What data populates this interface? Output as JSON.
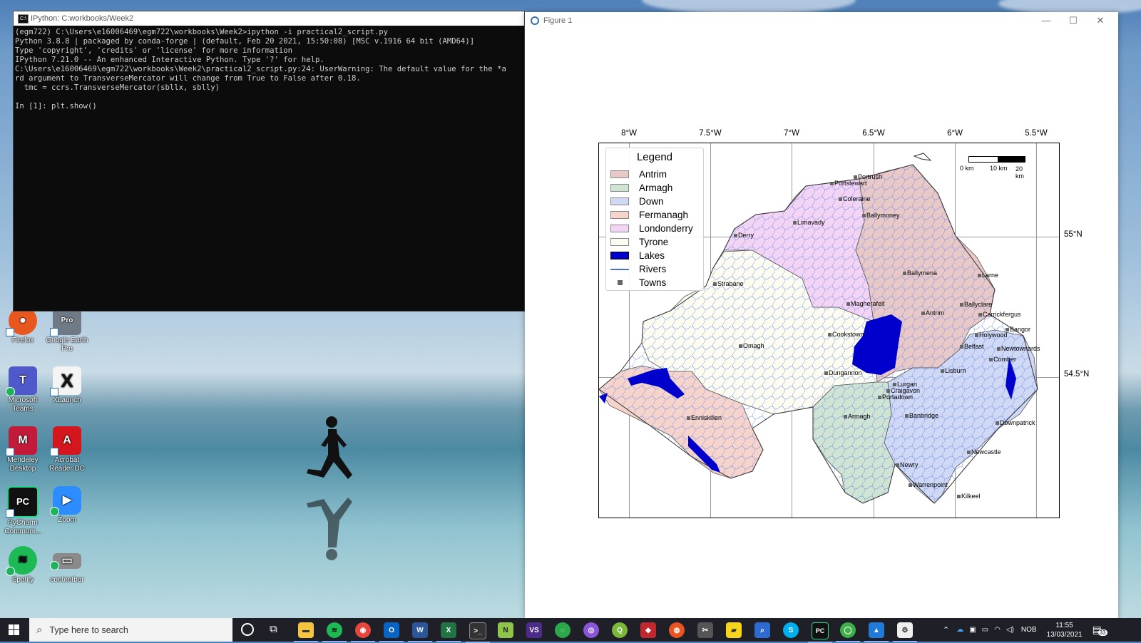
{
  "desktop": {
    "icons": [
      {
        "label": "Firefox",
        "color": "#e8571e",
        "glyph": "●"
      },
      {
        "label": "Google Earth Pro",
        "color": "#6f7a86",
        "glyph": "Pro"
      },
      {
        "label": "Microsoft Teams",
        "color": "#5059c9",
        "glyph": "T"
      },
      {
        "label": "XLaunch",
        "color": "#f4f4f4",
        "glyph": "X"
      },
      {
        "label": "Mendeley Desktop",
        "color": "#c31a3a",
        "glyph": "M"
      },
      {
        "label": "Acrobat Reader DC",
        "color": "#d4161e",
        "glyph": "A"
      },
      {
        "label": "PyCharm Communi...",
        "color": "#111111",
        "glyph": "PC"
      },
      {
        "label": "Zoom",
        "color": "#2d8cff",
        "glyph": "▶"
      },
      {
        "label": "Spotify",
        "color": "#1db954",
        "glyph": "≋"
      },
      {
        "label": "contentbar",
        "color": "#8a8a8a",
        "glyph": "▭"
      }
    ]
  },
  "console": {
    "title": "IPython: C:workbooks/Week2",
    "lines": [
      "(egm722) C:\\Users\\e16006469\\egm722\\workbooks\\Week2>ipython -i practical2_script.py",
      "Python 3.8.8 | packaged by conda-forge | (default, Feb 20 2021, 15:50:08) [MSC v.1916 64 bit (AMD64)]",
      "Type 'copyright', 'credits' or 'license' for more information",
      "IPython 7.21.0 -- An enhanced Interactive Python. Type '?' for help.",
      "C:\\Users\\e16006469\\egm722\\workbooks\\Week2\\practical2_script.py:24: UserWarning: The default value for the *a",
      "rd argument to TransverseMercator will change from True to False after 0.18.",
      "  tmc = ccrs.TransverseMercator(sbllx, sblly)",
      "",
      "In [1]: plt.show()"
    ]
  },
  "figure": {
    "title": "Figure 1",
    "buttons": {
      "minimize": "—",
      "maximize": "☐",
      "close": "✕"
    }
  },
  "chart_data": {
    "type": "map",
    "lon_ticks": [
      "8°W",
      "7.5°W",
      "7°W",
      "6.5°W",
      "6°W",
      "5.5°W"
    ],
    "lat_ticks": [
      "55°N",
      "54.5°N"
    ],
    "legend": {
      "title": "Legend",
      "items": [
        {
          "label": "Antrim",
          "color": "#e9c8c8",
          "kind": "patch"
        },
        {
          "label": "Armagh",
          "color": "#cfe4d2",
          "kind": "patch"
        },
        {
          "label": "Down",
          "color": "#cfd8f5",
          "kind": "patch"
        },
        {
          "label": "Fermanagh",
          "color": "#f6d4cc",
          "kind": "patch"
        },
        {
          "label": "Londonderry",
          "color": "#f4d4f4",
          "kind": "patch"
        },
        {
          "label": "Tyrone",
          "color": "#fcfcf0",
          "kind": "patch"
        },
        {
          "label": "Lakes",
          "color": "#0000cc",
          "kind": "patch"
        },
        {
          "label": "Rivers",
          "color": "#4a6fd8",
          "kind": "line"
        },
        {
          "label": "Towns",
          "color": "#666666",
          "kind": "marker"
        }
      ]
    },
    "scale_bar": {
      "labels": [
        "0 km",
        "10 km",
        "20 km"
      ]
    },
    "towns": [
      "Portrush",
      "Portstewart",
      "Coleraine",
      "Ballymoney",
      "Limavady",
      "Derry",
      "Ballymena",
      "Larne",
      "Strabane",
      "Magherafelt",
      "Antrim",
      "Ballyclare",
      "Carrickfergus",
      "Bangor",
      "Holywood",
      "Cookstown",
      "Belfast",
      "Newtownards",
      "Omagh",
      "Comber",
      "Dungannon",
      "Lisburn",
      "Lurgan",
      "Craigavon",
      "Portadown",
      "Armagh",
      "Banbridge",
      "Enniskillen",
      "Downpatrick",
      "Newcastle",
      "Newry",
      "Warrenpoint",
      "Kilkeel"
    ]
  },
  "taskbar": {
    "search_placeholder": "Type here to search",
    "apps": [
      {
        "name": "File Explorer",
        "color": "#f5c542",
        "glyph": "▬"
      },
      {
        "name": "Spotify",
        "color": "#1db954",
        "glyph": "≋"
      },
      {
        "name": "Chrome",
        "color": "#e8453c",
        "glyph": "◉"
      },
      {
        "name": "Outlook",
        "color": "#0a64c2",
        "glyph": "O"
      },
      {
        "name": "Word",
        "color": "#2b579a",
        "glyph": "W"
      },
      {
        "name": "Excel",
        "color": "#217346",
        "glyph": "X"
      },
      {
        "name": "Terminal",
        "color": "#333333",
        "glyph": ">_"
      },
      {
        "name": "Notepad++",
        "color": "#8fc44a",
        "glyph": "N"
      },
      {
        "name": "Visual Studio",
        "color": "#4b2c8a",
        "glyph": "VS"
      },
      {
        "name": "Refresh",
        "color": "#2aa84a",
        "glyph": "◌"
      },
      {
        "name": "Podcasts",
        "color": "#8a55d8",
        "glyph": "◎"
      },
      {
        "name": "QGIS",
        "color": "#7bb83a",
        "glyph": "Q"
      },
      {
        "name": "Security",
        "color": "#c0282d",
        "glyph": "◆"
      },
      {
        "name": "Ubuntu",
        "color": "#e95420",
        "glyph": "◍"
      },
      {
        "name": "Snip",
        "color": "#555555",
        "glyph": "✂"
      },
      {
        "name": "Sticky Notes",
        "color": "#f7d51d",
        "glyph": "▰"
      },
      {
        "name": "Magnifier",
        "color": "#2d6bd1",
        "glyph": "⌕"
      },
      {
        "name": "Skype",
        "color": "#00aff0",
        "glyph": "S"
      },
      {
        "name": "PyCharm",
        "color": "#21d789",
        "glyph": "PC"
      },
      {
        "name": "Anaconda",
        "color": "#3eb049",
        "glyph": "◯"
      },
      {
        "name": "Photos",
        "color": "#1f7ad9",
        "glyph": "▲"
      },
      {
        "name": "Matplotlib Figure",
        "color": "#eeeeee",
        "glyph": "⚙"
      }
    ],
    "language": "NOB",
    "time": "11:55",
    "date": "13/03/2021",
    "notification_count": "33"
  }
}
